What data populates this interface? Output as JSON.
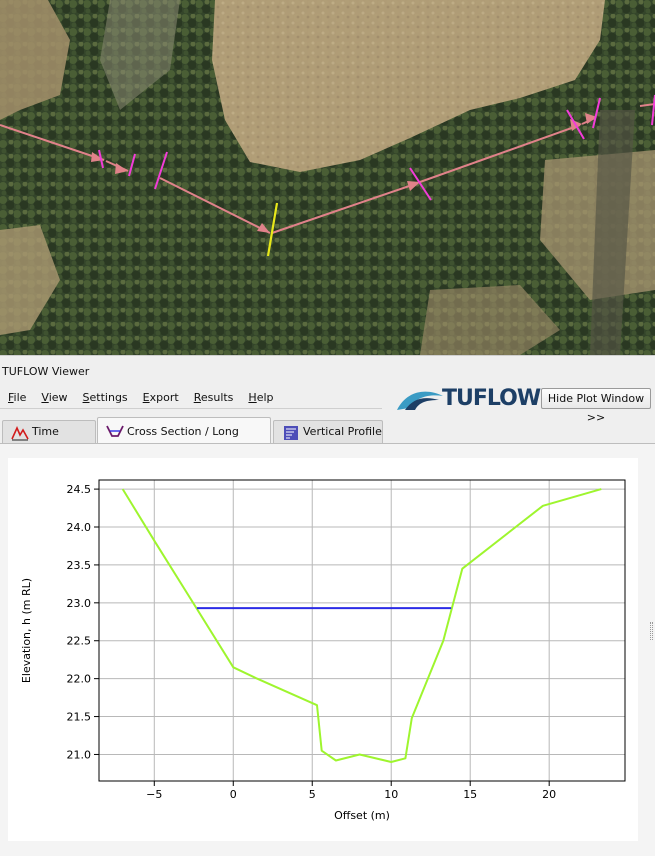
{
  "window_title": "TUFLOW Viewer",
  "menu": [
    {
      "label": "File",
      "mnemonic": "F",
      "rest": "ile"
    },
    {
      "label": "View",
      "mnemonic": "V",
      "rest": "iew"
    },
    {
      "label": "Settings",
      "mnemonic": "S",
      "rest": "ettings"
    },
    {
      "label": "Export",
      "mnemonic": "E",
      "rest": "xport"
    },
    {
      "label": "Results",
      "mnemonic": "R",
      "rest": "esults"
    },
    {
      "label": "Help",
      "mnemonic": "H",
      "rest": "elp"
    }
  ],
  "logo_text": "TUFLOW",
  "hide_plot_button": "Hide Plot Window >>",
  "tabs": [
    {
      "label": "Time Series",
      "icon": "time-series-icon",
      "active": false
    },
    {
      "label": "Cross Section / Long Profile",
      "icon": "cross-section-icon",
      "active": true
    },
    {
      "label": "Vertical Profile",
      "icon": "vertical-profile-icon",
      "active": false
    }
  ],
  "colors": {
    "logo_blue": "#1d3f66",
    "logo_wave": "#3a9bc4",
    "ground_line": "#9ef52e",
    "water_line": "#2b2be6",
    "map_flow_arrow": "#e0828a",
    "map_section_magenta": "#f23cd8",
    "map_section_yellow": "#e8e81a"
  },
  "chart_data": {
    "type": "line",
    "xlabel": "Offset (m)",
    "ylabel": "Elevation, h (m RL)",
    "xlim": [
      -8.5,
      24.8
    ],
    "ylim": [
      20.65,
      24.62
    ],
    "x_ticks": [
      -5,
      0,
      5,
      10,
      15,
      20
    ],
    "x_tick_labels": [
      "−5",
      "0",
      "5",
      "10",
      "15",
      "20"
    ],
    "y_ticks": [
      21.0,
      21.5,
      22.0,
      22.5,
      23.0,
      23.5,
      24.0,
      24.5
    ],
    "y_tick_labels": [
      "21.0",
      "21.5",
      "22.0",
      "22.5",
      "23.0",
      "23.5",
      "24.0",
      "24.5"
    ],
    "grid": true,
    "series": [
      {
        "x": [
          -7.0,
          -5.0,
          -2.3,
          0.0,
          1.5,
          5.3,
          5.6,
          6.5,
          8.0,
          10.0,
          10.9,
          11.3,
          13.3,
          14.5,
          19.6,
          23.3
        ],
        "y": [
          24.5,
          23.82,
          22.92,
          22.15,
          22.0,
          21.65,
          21.05,
          20.92,
          21.0,
          20.9,
          20.95,
          21.48,
          22.5,
          23.45,
          24.28,
          24.5
        ]
      },
      {
        "x": [
          -2.3,
          13.8
        ],
        "y": [
          22.93,
          22.93
        ]
      }
    ]
  }
}
